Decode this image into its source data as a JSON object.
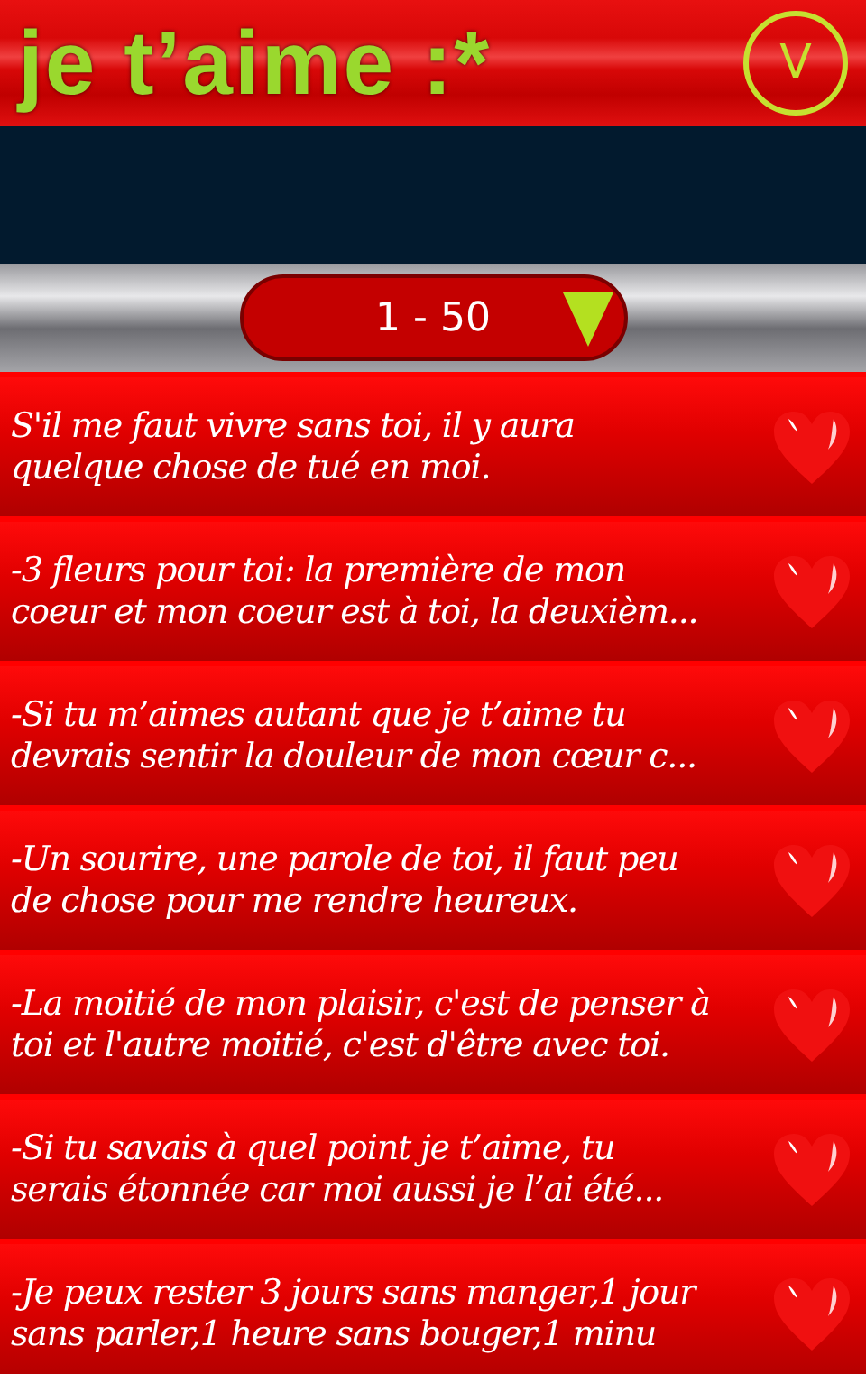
{
  "header": {
    "title": "je t’aime :*",
    "menu_button": "V"
  },
  "range_selector": {
    "label": "1 - 50"
  },
  "quotes": [
    {
      "text": "S'il me faut vivre sans toi, il y aura\nquelque chose de tué en moi."
    },
    {
      "text": "-3 fleurs pour toi: la première de mon\ncoeur et mon coeur est à toi, la deuxièm..."
    },
    {
      "text": "-Si tu m’aimes autant que je t’aime tu\ndevrais sentir la douleur de mon cœur c..."
    },
    {
      "text": "-Un sourire, une parole de toi, il faut peu\nde chose pour me rendre heureux."
    },
    {
      "text": "-La moitié de mon plaisir, c'est de penser à\ntoi et l'autre moitié, c'est d'être avec toi."
    },
    {
      "text": "-Si tu savais à quel point je t’aime, tu\nserais étonnée car moi aussi je l’ai été..."
    },
    {
      "text": "-Je peux rester 3 jours sans manger,1 jour\nsans parler,1 heure sans bouger,1 minu"
    }
  ]
}
